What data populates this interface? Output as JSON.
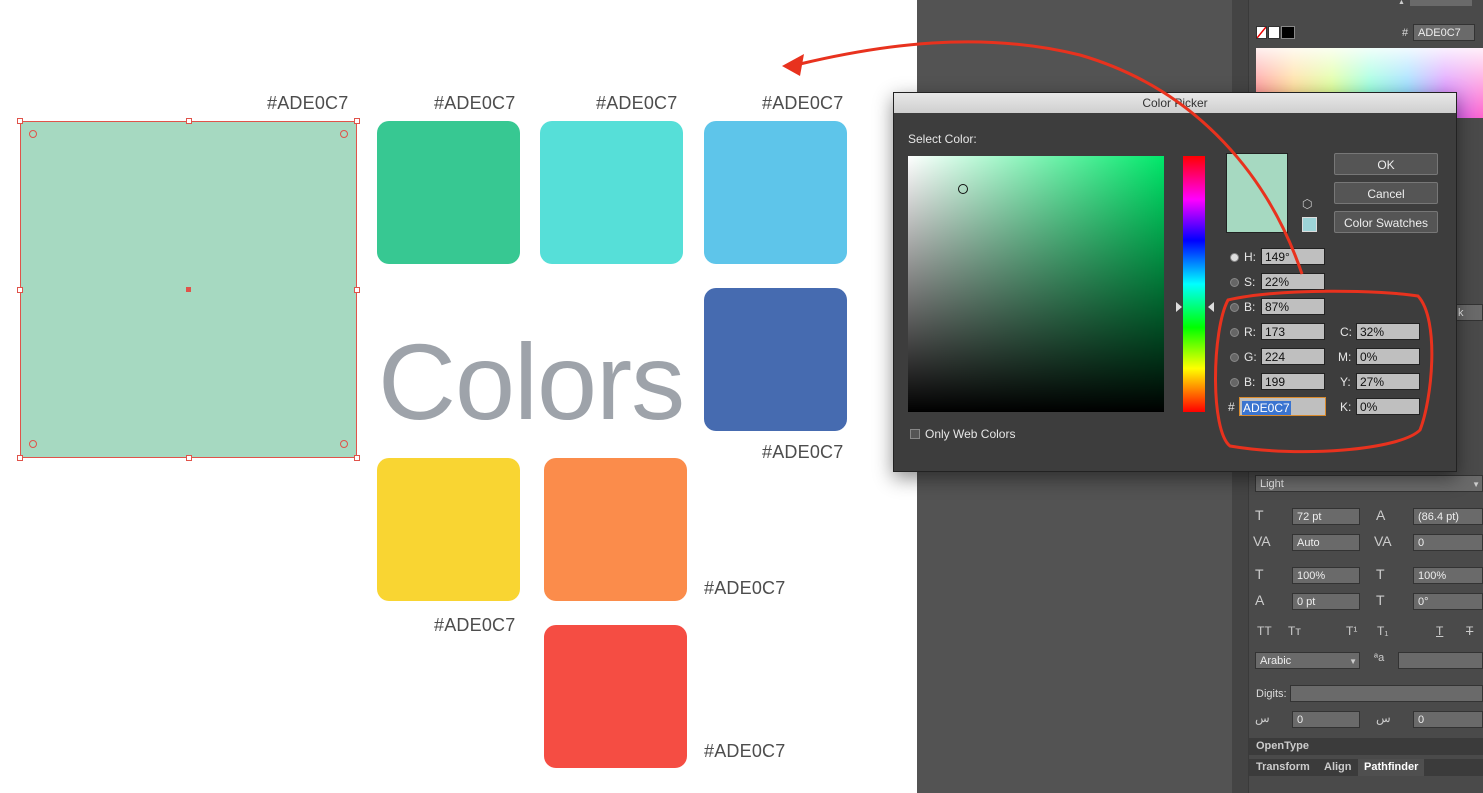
{
  "canvas": {
    "swatch_labels": [
      "#ADE0C7",
      "#ADE0C7",
      "#ADE0C7",
      "#ADE0C7",
      "#ADE0C7",
      "#ADE0C7",
      "#ADE0C7",
      "#ADE0C7",
      "#ADE0C7"
    ],
    "heading": "Colors",
    "swatch_colors": [
      "#a6d9c1",
      "#37c892",
      "#56dfd8",
      "#5ec5ea",
      "#466bb0",
      "#f9d532",
      "#fb8c4b",
      "#f54d43"
    ]
  },
  "color_picker": {
    "title": "Color Picker",
    "select_color_label": "Select Color:",
    "buttons": {
      "ok": "OK",
      "cancel": "Cancel",
      "swatches": "Color Swatches"
    },
    "hsb": {
      "h_label": "H:",
      "h_value": "149°",
      "s_label": "S:",
      "s_value": "22%",
      "b_label": "B:",
      "b_value": "87%"
    },
    "rgb": {
      "r_label": "R:",
      "r_value": "173",
      "g_label": "G:",
      "g_value": "224",
      "b_label": "B:",
      "b_value": "199"
    },
    "cmyk": {
      "c_label": "C:",
      "c_value": "32%",
      "m_label": "M:",
      "m_value": "0%",
      "y_label": "Y:",
      "y_value": "27%",
      "k_label": "K:",
      "k_value": "0%"
    },
    "hex_label": "#",
    "hex_value": "ADE0C7",
    "web_only_label": "Only Web Colors",
    "selected_color": "#a6d9c1"
  },
  "right_panel": {
    "hex_label": "#",
    "hex_value": "ADE0C7",
    "font_style": "Light",
    "font_size": "72 pt",
    "leading": "(86.4 pt)",
    "kerning": "Auto",
    "tracking": "0",
    "vscale": "100%",
    "hscale": "100%",
    "baseline": "0 pt",
    "rotation": "0°",
    "language": "Arabic",
    "digits_label": "Digits:",
    "field_a": "0",
    "field_b": "0",
    "tabs": {
      "opentype": "OpenType",
      "transform": "Transform",
      "align": "Align",
      "pathfinder": "Pathfinder"
    },
    "k_fragment": "k"
  },
  "annotation": {
    "arrow_color": "#e8321e"
  }
}
